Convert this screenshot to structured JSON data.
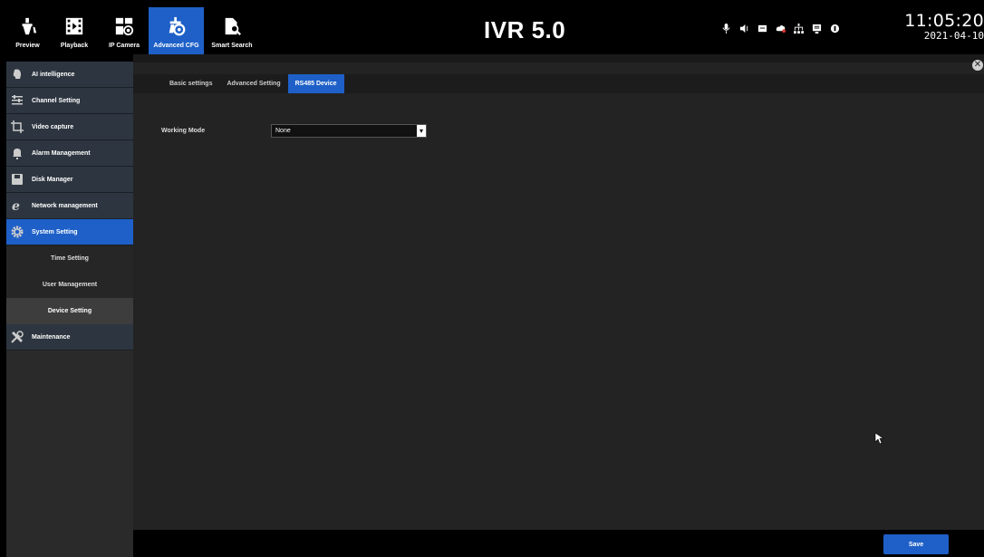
{
  "app": {
    "brand": "IVR 5.0"
  },
  "nav": [
    {
      "id": "preview",
      "label": "Preview",
      "icon": "preview-icon"
    },
    {
      "id": "playback",
      "label": "Playback",
      "icon": "playback-icon"
    },
    {
      "id": "ipcamera",
      "label": "IP Camera",
      "icon": "ip-camera-icon"
    },
    {
      "id": "advanced",
      "label": "Advanced CFG",
      "icon": "advanced-cfg-icon",
      "active": true
    },
    {
      "id": "smartsearch",
      "label": "Smart Search",
      "icon": "smart-search-icon"
    }
  ],
  "clock": {
    "time": "11:05:20",
    "date": "2021-04-10"
  },
  "status_icons": [
    "microphone-icon",
    "speaker-icon",
    "record-icon",
    "cloud-icon",
    "network-icon",
    "storage-icon",
    "alarm-icon"
  ],
  "sidebar": {
    "items": [
      {
        "label": "AI intelligence",
        "icon": "ai-icon"
      },
      {
        "label": "Channel Setting",
        "icon": "channel-icon"
      },
      {
        "label": "Video capture",
        "icon": "crop-icon"
      },
      {
        "label": "Alarm Management",
        "icon": "bell-icon"
      },
      {
        "label": "Disk Manager",
        "icon": "disk-icon"
      },
      {
        "label": "Network management",
        "icon": "network-globe-icon"
      },
      {
        "label": "System Setting",
        "icon": "gear-icon",
        "active": true
      },
      {
        "label": "Maintenance",
        "icon": "tools-icon"
      }
    ],
    "sub_items": [
      {
        "label": "Time Setting"
      },
      {
        "label": "User Management"
      },
      {
        "label": "Device Setting",
        "active": true
      }
    ]
  },
  "tabs": [
    {
      "label": "Basic settings"
    },
    {
      "label": "Advanced Setting"
    },
    {
      "label": "RS485 Device",
      "active": true
    }
  ],
  "form": {
    "working_mode_label": "Working Mode",
    "working_mode_value": "None"
  },
  "footer": {
    "save_label": "Save"
  },
  "colors": {
    "accent": "#1e60c8",
    "panel": "#232323",
    "sidebar": "#2d3640"
  }
}
